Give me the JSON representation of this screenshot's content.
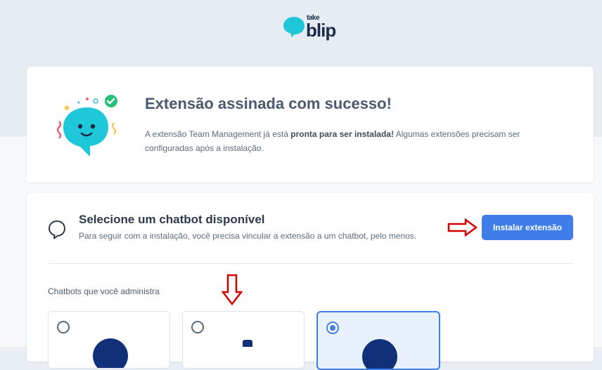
{
  "brand": {
    "take": "take",
    "blip": "blip",
    "color": "#1ec8d8",
    "text_color": "#1c2b4a"
  },
  "success": {
    "title": "Extensão assinada com sucesso!",
    "desc_part1": "A extensão Team Management já está ",
    "desc_bold": "pronta para ser instalada!",
    "desc_part2": " Algumas extensões precisam ser configuradas após a instalação."
  },
  "selection": {
    "title": "Selecione um chatbot disponível",
    "subtitle": "Para seguir com a instalação, você precisa vincular a extensão a um chatbot, pelo menos.",
    "install_label": "Instalar extensão",
    "section_label": "Chatbots que você administra"
  },
  "chatbots": [
    {
      "selected": false
    },
    {
      "selected": false
    },
    {
      "selected": true
    }
  ],
  "colors": {
    "accent": "#3f7de8",
    "annotation_arrow": "#d40000"
  }
}
